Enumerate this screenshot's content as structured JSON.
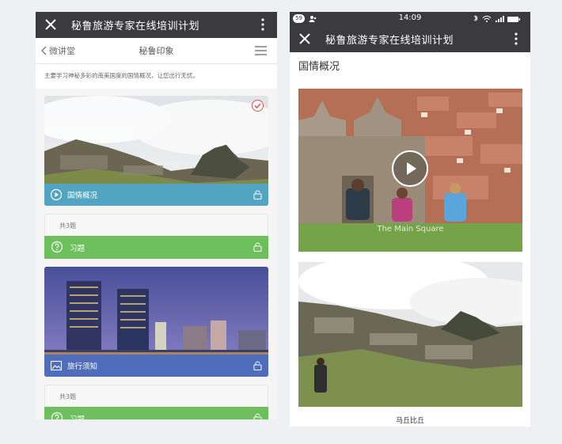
{
  "left_phone": {
    "title": "秘鲁旅游专家在线培训计划",
    "nav": {
      "back_label": "微讲堂",
      "title": "秘鲁印象"
    },
    "description": "主要学习神秘多彩的南美国度的国情概况，让您出行无忧。",
    "modules": [
      {
        "label": "国情概况",
        "banner_color": "#4aa8d6",
        "icon": "play-circle-icon",
        "completed": true
      },
      {
        "label": "旅行须知",
        "banner_color": "#5476c9",
        "icon": "image-icon",
        "completed": false
      }
    ],
    "quizzes": [
      {
        "count": "共3题",
        "label": "习题"
      },
      {
        "count": "共3题",
        "label": "习题"
      }
    ]
  },
  "right_phone": {
    "status": {
      "time": "14:09",
      "badge": "59"
    },
    "title": "秘鲁旅游专家在线培训计划",
    "section_title": "国情概况",
    "video_caption": "The Main Square",
    "image_caption": "马丘比丘"
  },
  "colors": {
    "titlebar": "#3b3b3f",
    "quiz_green": "#6dbe5c",
    "check_red": "#e24d4d"
  }
}
